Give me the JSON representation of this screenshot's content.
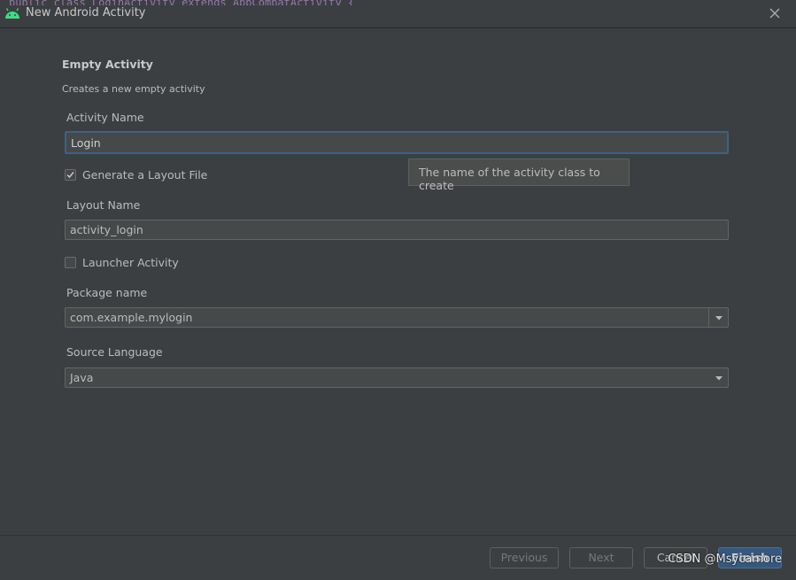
{
  "window": {
    "title": "New Android Activity",
    "code_peek": "public class LoginActivity extends AppCompatActivity {"
  },
  "template": {
    "heading": "Empty Activity",
    "description": "Creates a new empty activity"
  },
  "fields": {
    "activity_name": {
      "label": "Activity Name",
      "value": "Login"
    },
    "generate_layout": {
      "label": "Generate a Layout File",
      "checked": true
    },
    "layout_name": {
      "label": "Layout Name",
      "value": "activity_login"
    },
    "launcher_activity": {
      "label": "Launcher Activity",
      "checked": false
    },
    "package_name": {
      "label": "Package name",
      "value": "com.example.mylogin"
    },
    "source_language": {
      "label": "Source Language",
      "value": "Java"
    }
  },
  "tooltip": {
    "text": "The name of the activity class to create"
  },
  "buttons": {
    "previous": "Previous",
    "next": "Next",
    "cancel": "Cancel",
    "finish": "Finish"
  },
  "watermark": "CSDN @Msycamore",
  "colors": {
    "android_green": "#3ddc84",
    "accent_focus": "#3d6185",
    "primary_button": "#365880"
  }
}
